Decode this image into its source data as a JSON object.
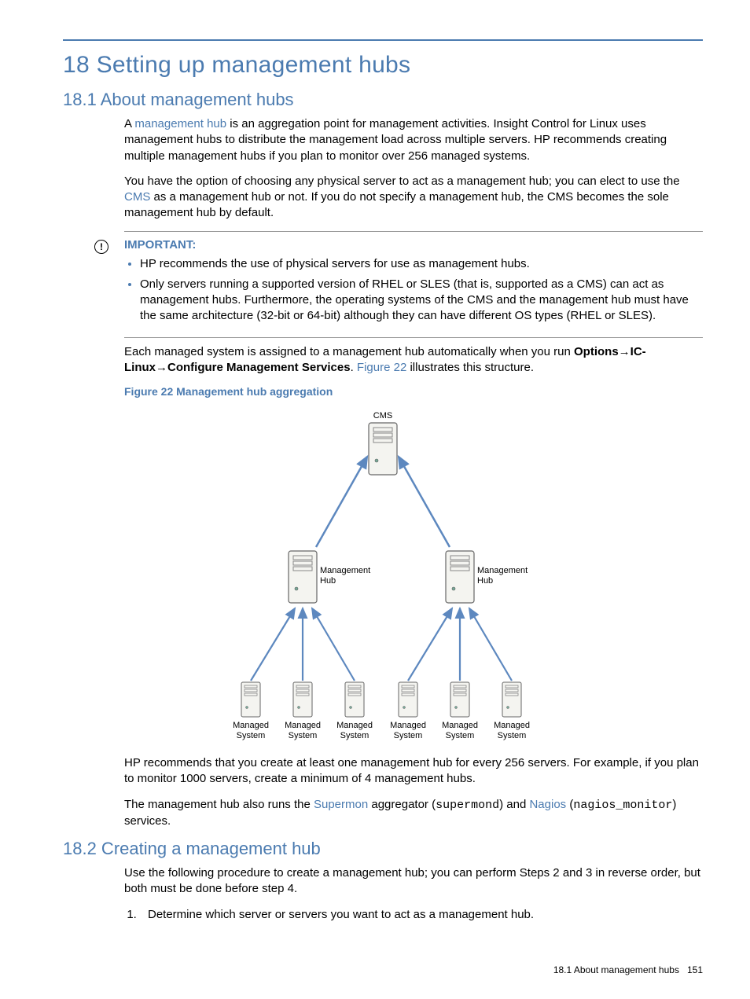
{
  "chapter_title": "18 Setting up management hubs",
  "sections": {
    "about": {
      "heading": "18.1 About management hubs",
      "p1_a": "A ",
      "p1_link": "management hub",
      "p1_b": " is an aggregation point for management activities. Insight Control for Linux uses management hubs to distribute the management load across multiple servers. HP recommends creating multiple management hubs if you plan to monitor over 256 managed systems.",
      "p2_a": "You have the option of choosing any physical server to act as a management hub; you can elect to use the ",
      "p2_link": "CMS",
      "p2_b": " as a management hub or not. If you do not specify a management hub, the CMS becomes the sole management hub by default.",
      "important_label": "IMPORTANT:",
      "important_items": [
        "HP recommends the use of physical servers for use as management hubs.",
        "Only servers running a supported version of RHEL or SLES (that is, supported as a CMS) can act as management hubs. Furthermore, the operating systems of the CMS and the management hub must have the same architecture (32-bit or 64-bit) although they can have different OS types (RHEL or SLES)."
      ],
      "p3_a": "Each managed system is assigned to a management hub automatically when you run ",
      "p3_menu": "Options→IC-Linux→Configure Management Services",
      "p3_b": ". ",
      "p3_link": "Figure 22",
      "p3_c": " illustrates this structure.",
      "figure_caption": "Figure 22 Management hub aggregation",
      "p4": "HP recommends that you create at least one management hub for every 256 servers. For example, if you plan to monitor 1000 servers, create a minimum of 4 management hubs.",
      "p5_a": "The management hub also runs the ",
      "p5_link1": "Supermon",
      "p5_b": " aggregator (",
      "p5_mono1": "supermond",
      "p5_c": ") and ",
      "p5_link2": "Nagios",
      "p5_d": " (",
      "p5_mono2": "nagios_monitor",
      "p5_e": ") services."
    },
    "creating": {
      "heading": "18.2 Creating a management hub",
      "intro": "Use the following procedure to create a management hub; you can perform Steps 2 and 3 in reverse order, but both must be done before step 4.",
      "step1": "Determine which server or servers you want to act as a management hub."
    }
  },
  "diagram": {
    "cms": "CMS",
    "hub": "Management\nHub",
    "managed": "Managed\nSystem"
  },
  "footer": {
    "section_ref": "18.1 About management hubs",
    "page_num": "151"
  }
}
